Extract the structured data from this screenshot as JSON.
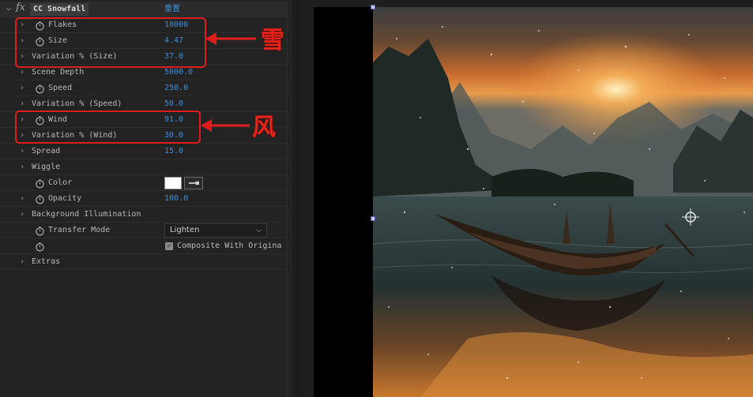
{
  "effect": {
    "name": "CC Snowfall",
    "reset_label": "重置"
  },
  "properties": [
    {
      "label": "Flakes",
      "value": "10000",
      "has_stopwatch": true,
      "expandable": true
    },
    {
      "label": "Size",
      "value": "4.47",
      "has_stopwatch": true,
      "expandable": true
    },
    {
      "label": "Variation % (Size)",
      "value": "37.0",
      "has_stopwatch": false,
      "expandable": true
    },
    {
      "label": "Scene Depth",
      "value": "5000.0",
      "has_stopwatch": false,
      "expandable": true
    },
    {
      "label": "Speed",
      "value": "250.0",
      "has_stopwatch": true,
      "expandable": true
    },
    {
      "label": "Variation % (Speed)",
      "value": "50.0",
      "has_stopwatch": false,
      "expandable": true
    },
    {
      "label": "Wind",
      "value": "91.0",
      "has_stopwatch": true,
      "expandable": true
    },
    {
      "label": "Variation % (Wind)",
      "value": "30.0",
      "has_stopwatch": false,
      "expandable": true
    },
    {
      "label": "Spread",
      "value": "15.0",
      "has_stopwatch": false,
      "expandable": true
    },
    {
      "label": "Wiggle",
      "value": "",
      "has_stopwatch": false,
      "expandable": true
    },
    {
      "label": "Color",
      "value": "",
      "has_stopwatch": true,
      "expandable": false,
      "color_value": "#ffffff"
    },
    {
      "label": "Opacity",
      "value": "100.0",
      "has_stopwatch": true,
      "expandable": true
    },
    {
      "label": "Background Illumination",
      "value": "",
      "has_stopwatch": false,
      "expandable": true
    },
    {
      "label": "Transfer Mode",
      "value": "",
      "has_stopwatch": true,
      "expandable": false
    },
    {
      "label": "",
      "value": "",
      "has_stopwatch": true,
      "expandable": false
    },
    {
      "label": "Extras",
      "value": "",
      "has_stopwatch": false,
      "expandable": true
    }
  ],
  "transfer_mode": {
    "selected": "Lighten"
  },
  "composite": {
    "label": "Composite With Origina",
    "checked": true
  },
  "annotations": {
    "snow": "雪",
    "wind": "风",
    "color": "#e01d1d"
  },
  "icons": {
    "expand": "chevron-right-icon",
    "stopwatch": "stopwatch-icon",
    "eyedropper": "eyedropper-icon",
    "fx": "fx-icon",
    "anchor": "anchor-point-icon"
  },
  "colors": {
    "value_blue": "#3d8fd8",
    "panel_bg": "#232323",
    "label_text": "#b8b8b8"
  }
}
